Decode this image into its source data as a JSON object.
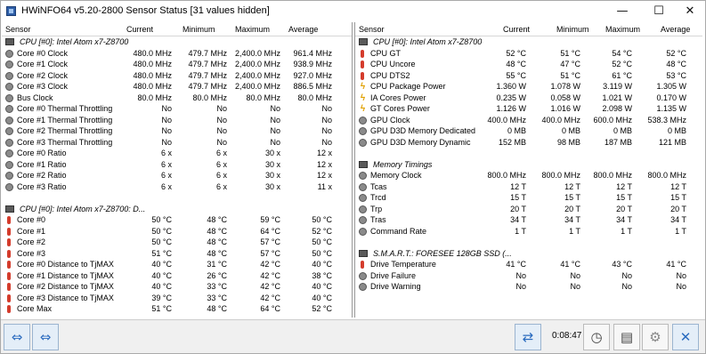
{
  "window": {
    "title": "HWiNFO64 v5.20-2800 Sensor Status [31 values hidden]",
    "min": "—",
    "max": "☐",
    "close": "✕"
  },
  "headers": {
    "sensor": "Sensor",
    "current": "Current",
    "minimum": "Minimum",
    "maximum": "Maximum",
    "average": "Average"
  },
  "left": [
    {
      "g": "CPU [#0]: Intel Atom x7-Z8700"
    },
    {
      "n": "Core #0 Clock",
      "c": "480.0 MHz",
      "mn": "479.7 MHz",
      "mx": "2,400.0 MHz",
      "av": "961.4 MHz",
      "i": "round"
    },
    {
      "n": "Core #1 Clock",
      "c": "480.0 MHz",
      "mn": "479.7 MHz",
      "mx": "2,400.0 MHz",
      "av": "938.9 MHz",
      "i": "round"
    },
    {
      "n": "Core #2 Clock",
      "c": "480.0 MHz",
      "mn": "479.7 MHz",
      "mx": "2,400.0 MHz",
      "av": "927.0 MHz",
      "i": "round"
    },
    {
      "n": "Core #3 Clock",
      "c": "480.0 MHz",
      "mn": "479.7 MHz",
      "mx": "2,400.0 MHz",
      "av": "886.5 MHz",
      "i": "round"
    },
    {
      "n": "Bus Clock",
      "c": "80.0 MHz",
      "mn": "80.0 MHz",
      "mx": "80.0 MHz",
      "av": "80.0 MHz",
      "i": "round"
    },
    {
      "n": "Core #0 Thermal Throttling",
      "c": "No",
      "mn": "No",
      "mx": "No",
      "av": "No",
      "i": "round"
    },
    {
      "n": "Core #1 Thermal Throttling",
      "c": "No",
      "mn": "No",
      "mx": "No",
      "av": "No",
      "i": "round"
    },
    {
      "n": "Core #2 Thermal Throttling",
      "c": "No",
      "mn": "No",
      "mx": "No",
      "av": "No",
      "i": "round"
    },
    {
      "n": "Core #3 Thermal Throttling",
      "c": "No",
      "mn": "No",
      "mx": "No",
      "av": "No",
      "i": "round"
    },
    {
      "n": "Core #0 Ratio",
      "c": "6 x",
      "mn": "6 x",
      "mx": "30 x",
      "av": "12 x",
      "i": "round"
    },
    {
      "n": "Core #1 Ratio",
      "c": "6 x",
      "mn": "6 x",
      "mx": "30 x",
      "av": "12 x",
      "i": "round"
    },
    {
      "n": "Core #2 Ratio",
      "c": "6 x",
      "mn": "6 x",
      "mx": "30 x",
      "av": "12 x",
      "i": "round"
    },
    {
      "n": "Core #3 Ratio",
      "c": "6 x",
      "mn": "6 x",
      "mx": "30 x",
      "av": "11 x",
      "i": "round"
    },
    {
      "blank": true
    },
    {
      "g": "CPU [#0]: Intel Atom x7-Z8700: D..."
    },
    {
      "n": "Core #0",
      "c": "50 °C",
      "mn": "48 °C",
      "mx": "59 °C",
      "av": "50 °C",
      "i": "temp"
    },
    {
      "n": "Core #1",
      "c": "50 °C",
      "mn": "48 °C",
      "mx": "64 °C",
      "av": "52 °C",
      "i": "temp"
    },
    {
      "n": "Core #2",
      "c": "50 °C",
      "mn": "48 °C",
      "mx": "57 °C",
      "av": "50 °C",
      "i": "temp"
    },
    {
      "n": "Core #3",
      "c": "51 °C",
      "mn": "48 °C",
      "mx": "57 °C",
      "av": "50 °C",
      "i": "temp"
    },
    {
      "n": "Core #0 Distance to TjMAX",
      "c": "40 °C",
      "mn": "31 °C",
      "mx": "42 °C",
      "av": "40 °C",
      "i": "temp"
    },
    {
      "n": "Core #1 Distance to TjMAX",
      "c": "40 °C",
      "mn": "26 °C",
      "mx": "42 °C",
      "av": "38 °C",
      "i": "temp"
    },
    {
      "n": "Core #2 Distance to TjMAX",
      "c": "40 °C",
      "mn": "33 °C",
      "mx": "42 °C",
      "av": "40 °C",
      "i": "temp"
    },
    {
      "n": "Core #3 Distance to TjMAX",
      "c": "39 °C",
      "mn": "33 °C",
      "mx": "42 °C",
      "av": "40 °C",
      "i": "temp"
    },
    {
      "n": "Core Max",
      "c": "51 °C",
      "mn": "48 °C",
      "mx": "64 °C",
      "av": "52 °C",
      "i": "temp"
    }
  ],
  "right": [
    {
      "g": "CPU [#0]: Intel Atom x7-Z8700"
    },
    {
      "n": "CPU GT",
      "c": "52 °C",
      "mn": "51 °C",
      "mx": "54 °C",
      "av": "52 °C",
      "i": "temp"
    },
    {
      "n": "CPU Uncore",
      "c": "48 °C",
      "mn": "47 °C",
      "mx": "52 °C",
      "av": "48 °C",
      "i": "temp"
    },
    {
      "n": "CPU DTS2",
      "c": "55 °C",
      "mn": "51 °C",
      "mx": "61 °C",
      "av": "53 °C",
      "i": "temp"
    },
    {
      "n": "CPU Package Power",
      "c": "1.360 W",
      "mn": "1.078 W",
      "mx": "3.119 W",
      "av": "1.305 W",
      "i": "volt"
    },
    {
      "n": "IA Cores Power",
      "c": "0.235 W",
      "mn": "0.058 W",
      "mx": "1.021 W",
      "av": "0.170 W",
      "i": "volt"
    },
    {
      "n": "GT Cores Power",
      "c": "1.126 W",
      "mn": "1.016 W",
      "mx": "2.098 W",
      "av": "1.135 W",
      "i": "volt"
    },
    {
      "n": "GPU Clock",
      "c": "400.0 MHz",
      "mn": "400.0 MHz",
      "mx": "600.0 MHz",
      "av": "538.3 MHz",
      "i": "round"
    },
    {
      "n": "GPU D3D Memory Dedicated",
      "c": "0 MB",
      "mn": "0 MB",
      "mx": "0 MB",
      "av": "0 MB",
      "i": "round"
    },
    {
      "n": "GPU D3D Memory Dynamic",
      "c": "152 MB",
      "mn": "98 MB",
      "mx": "187 MB",
      "av": "121 MB",
      "i": "round"
    },
    {
      "blank": true
    },
    {
      "g": "Memory Timings"
    },
    {
      "n": "Memory Clock",
      "c": "800.0 MHz",
      "mn": "800.0 MHz",
      "mx": "800.0 MHz",
      "av": "800.0 MHz",
      "i": "round"
    },
    {
      "n": "Tcas",
      "c": "12 T",
      "mn": "12 T",
      "mx": "12 T",
      "av": "12 T",
      "i": "round"
    },
    {
      "n": "Trcd",
      "c": "15 T",
      "mn": "15 T",
      "mx": "15 T",
      "av": "15 T",
      "i": "round"
    },
    {
      "n": "Trp",
      "c": "20 T",
      "mn": "20 T",
      "mx": "20 T",
      "av": "20 T",
      "i": "round"
    },
    {
      "n": "Tras",
      "c": "34 T",
      "mn": "34 T",
      "mx": "34 T",
      "av": "34 T",
      "i": "round"
    },
    {
      "n": "Command Rate",
      "c": "1 T",
      "mn": "1 T",
      "mx": "1 T",
      "av": "1 T",
      "i": "round"
    },
    {
      "blank": true
    },
    {
      "g": "S.M.A.R.T.: FORESEE 128GB SSD (..."
    },
    {
      "n": "Drive Temperature",
      "c": "41 °C",
      "mn": "41 °C",
      "mx": "43 °C",
      "av": "41 °C",
      "i": "temp"
    },
    {
      "n": "Drive Failure",
      "c": "No",
      "mn": "No",
      "mx": "No",
      "av": "No",
      "i": "round"
    },
    {
      "n": "Drive Warning",
      "c": "No",
      "mn": "No",
      "mx": "No",
      "av": "No",
      "i": "round"
    }
  ],
  "toolbar": {
    "timer": "0:08:47",
    "nav_left": "⇔",
    "nav_right": "⇔",
    "network": "⇄",
    "clock": "◷",
    "report": "▤",
    "settings": "⚙",
    "close": "✕"
  }
}
